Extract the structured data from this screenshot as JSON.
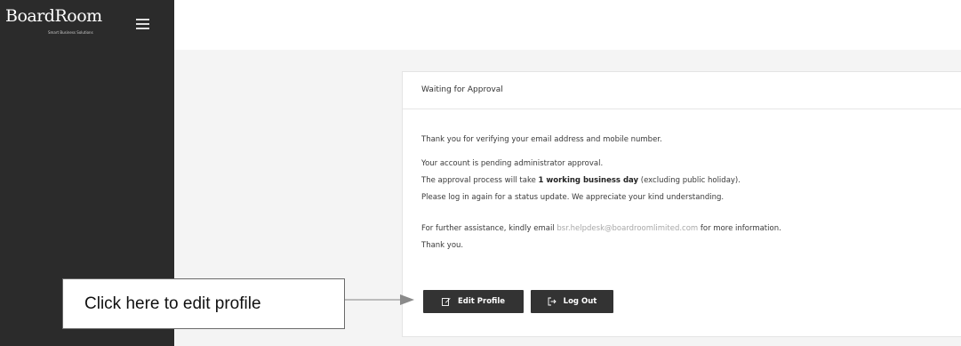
{
  "brand": {
    "name": "BoardRoom",
    "tagline": "Smart Business Solutions"
  },
  "card": {
    "title": "Waiting for Approval",
    "line1": "Thank you for verifying your email address and mobile number.",
    "line2": "Your account is pending administrator approval.",
    "line3_prefix": "The approval process will take ",
    "line3_bold": "1 working business day",
    "line3_suffix": " (excluding public holiday).",
    "line4": "Please log in again for a status update. We appreciate your kind understanding.",
    "line5_prefix": "For further assistance, kindly email ",
    "line5_email": "bsr.helpdesk@boardroomlimited.com",
    "line5_suffix": " for more information.",
    "line6": "Thank you."
  },
  "buttons": {
    "edit_label": "Edit Profile",
    "logout_label": "Log Out"
  },
  "callout": {
    "text": "Click here to edit profile"
  },
  "colors": {
    "sidebar": "#2b2b2b",
    "button": "#333333",
    "background": "#f4f4f4"
  }
}
